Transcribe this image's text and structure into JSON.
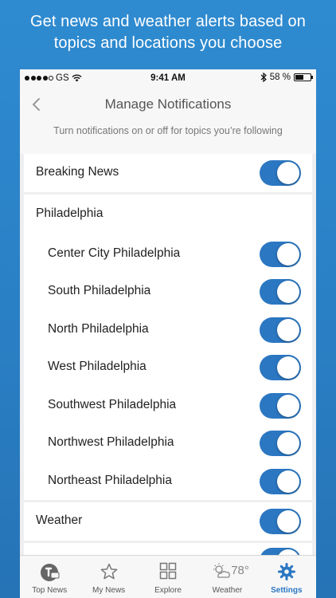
{
  "promo": {
    "line1": "Get news and weather alerts based on",
    "line2": "topics and locations you choose"
  },
  "status_bar": {
    "carrier": "GS",
    "time": "9:41 AM",
    "battery": "58 %",
    "battery_level": 0.58
  },
  "nav": {
    "title": "Manage Notifications",
    "back_icon": "chevron-left-icon"
  },
  "subtitle": "Turn notifications on or off for topics you’re following",
  "sections": {
    "breaking": {
      "label": "Breaking News",
      "on": true
    },
    "philadelphia": {
      "header": "Philadelphia",
      "items": [
        {
          "label": "Center City Philadelphia",
          "on": true
        },
        {
          "label": "South Philadelphia",
          "on": true
        },
        {
          "label": "North Philadelphia",
          "on": true
        },
        {
          "label": "West Philadelphia",
          "on": true
        },
        {
          "label": "Southwest Philadelphia",
          "on": true
        },
        {
          "label": "Northwest Philadelphia",
          "on": true
        },
        {
          "label": "Northeast Philadelphia",
          "on": true
        }
      ]
    },
    "weather": {
      "label": "Weather",
      "on": true
    }
  },
  "tab_bar": {
    "tabs": [
      {
        "label": "Top News",
        "icon": "top-news-icon"
      },
      {
        "label": "My News",
        "icon": "star-icon"
      },
      {
        "label": "Explore",
        "icon": "grid-icon"
      },
      {
        "label": "Weather",
        "icon": "partly-sunny-icon",
        "temp": "78°"
      },
      {
        "label": "Settings",
        "icon": "gear-icon",
        "active": true
      }
    ]
  },
  "colors": {
    "accent": "#2b77c2",
    "background_gradient_top": "#2f8bd0",
    "background_gradient_bottom": "#2673b6"
  }
}
